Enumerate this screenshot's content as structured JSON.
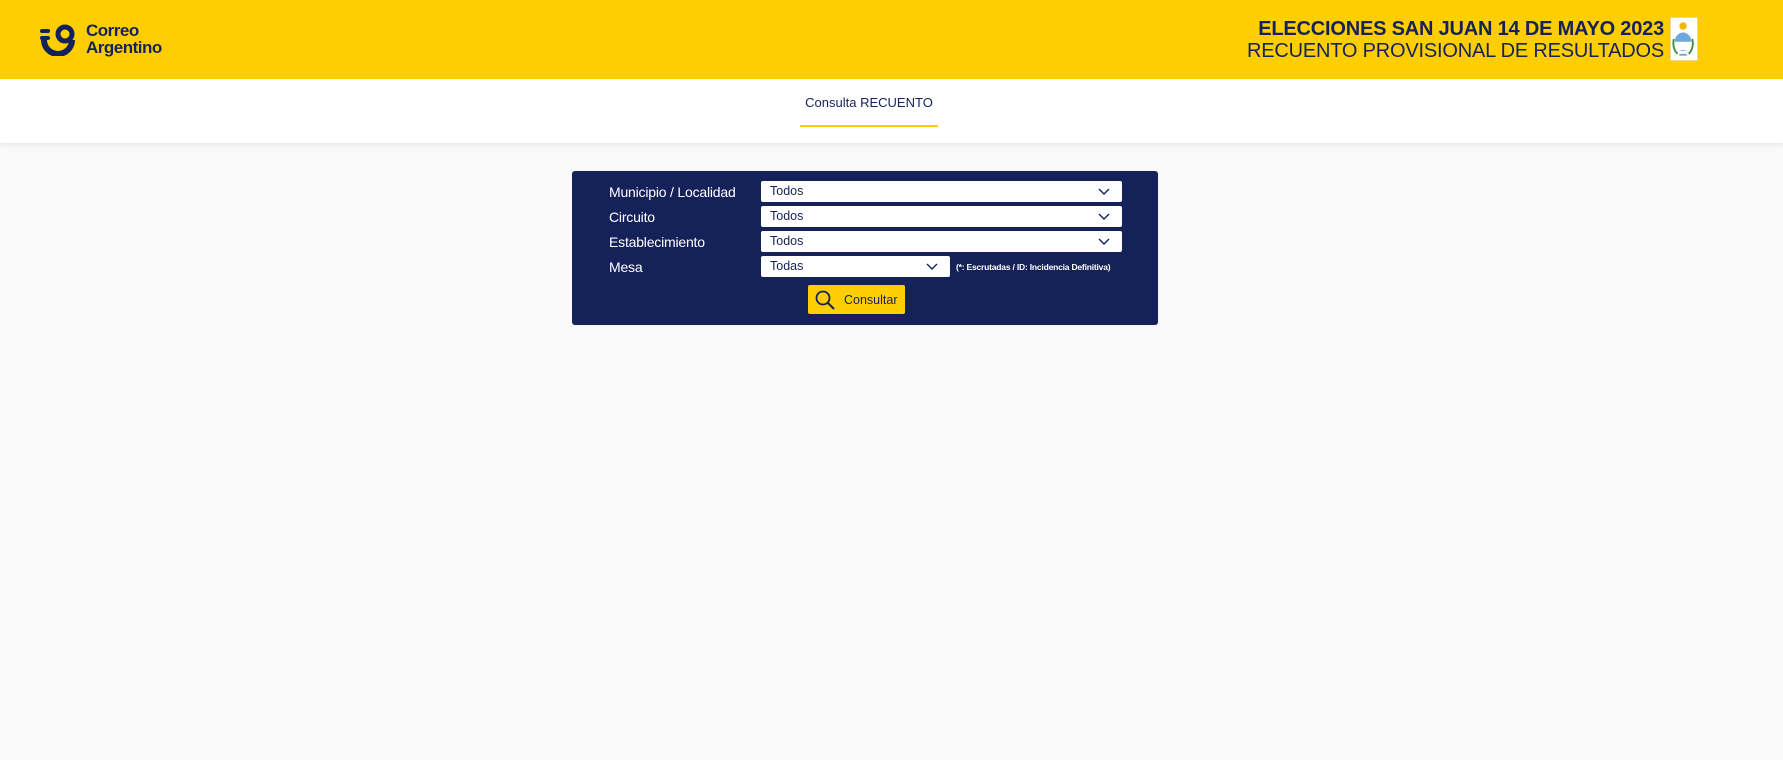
{
  "header": {
    "logo_line1": "Correo",
    "logo_line2": "Argentino",
    "title_line1": "ELECCIONES SAN JUAN 14 DE MAYO 2023",
    "title_line2": "RECUENTO PROVISIONAL DE RESULTADOS",
    "shield_icon": "san-juan-coat-of-arms-icon"
  },
  "nav": {
    "tab_label": "Consulta RECUENTO"
  },
  "form": {
    "municipio_label": "Municipio / Localidad",
    "municipio_value": "Todos",
    "circuito_label": "Circuito",
    "circuito_value": "Todos",
    "establecimiento_label": "Establecimiento",
    "establecimiento_value": "Todos",
    "mesa_label": "Mesa",
    "mesa_value": "Todas",
    "mesa_note": "(*: Escrutadas / ID: Incidencia Definitiva)",
    "consultar_label": "Consultar",
    "consultar_icon": "search-icon"
  },
  "colors": {
    "brand_yellow": "#ffce00",
    "brand_navy": "#152259",
    "background": "#f9f9f9"
  }
}
